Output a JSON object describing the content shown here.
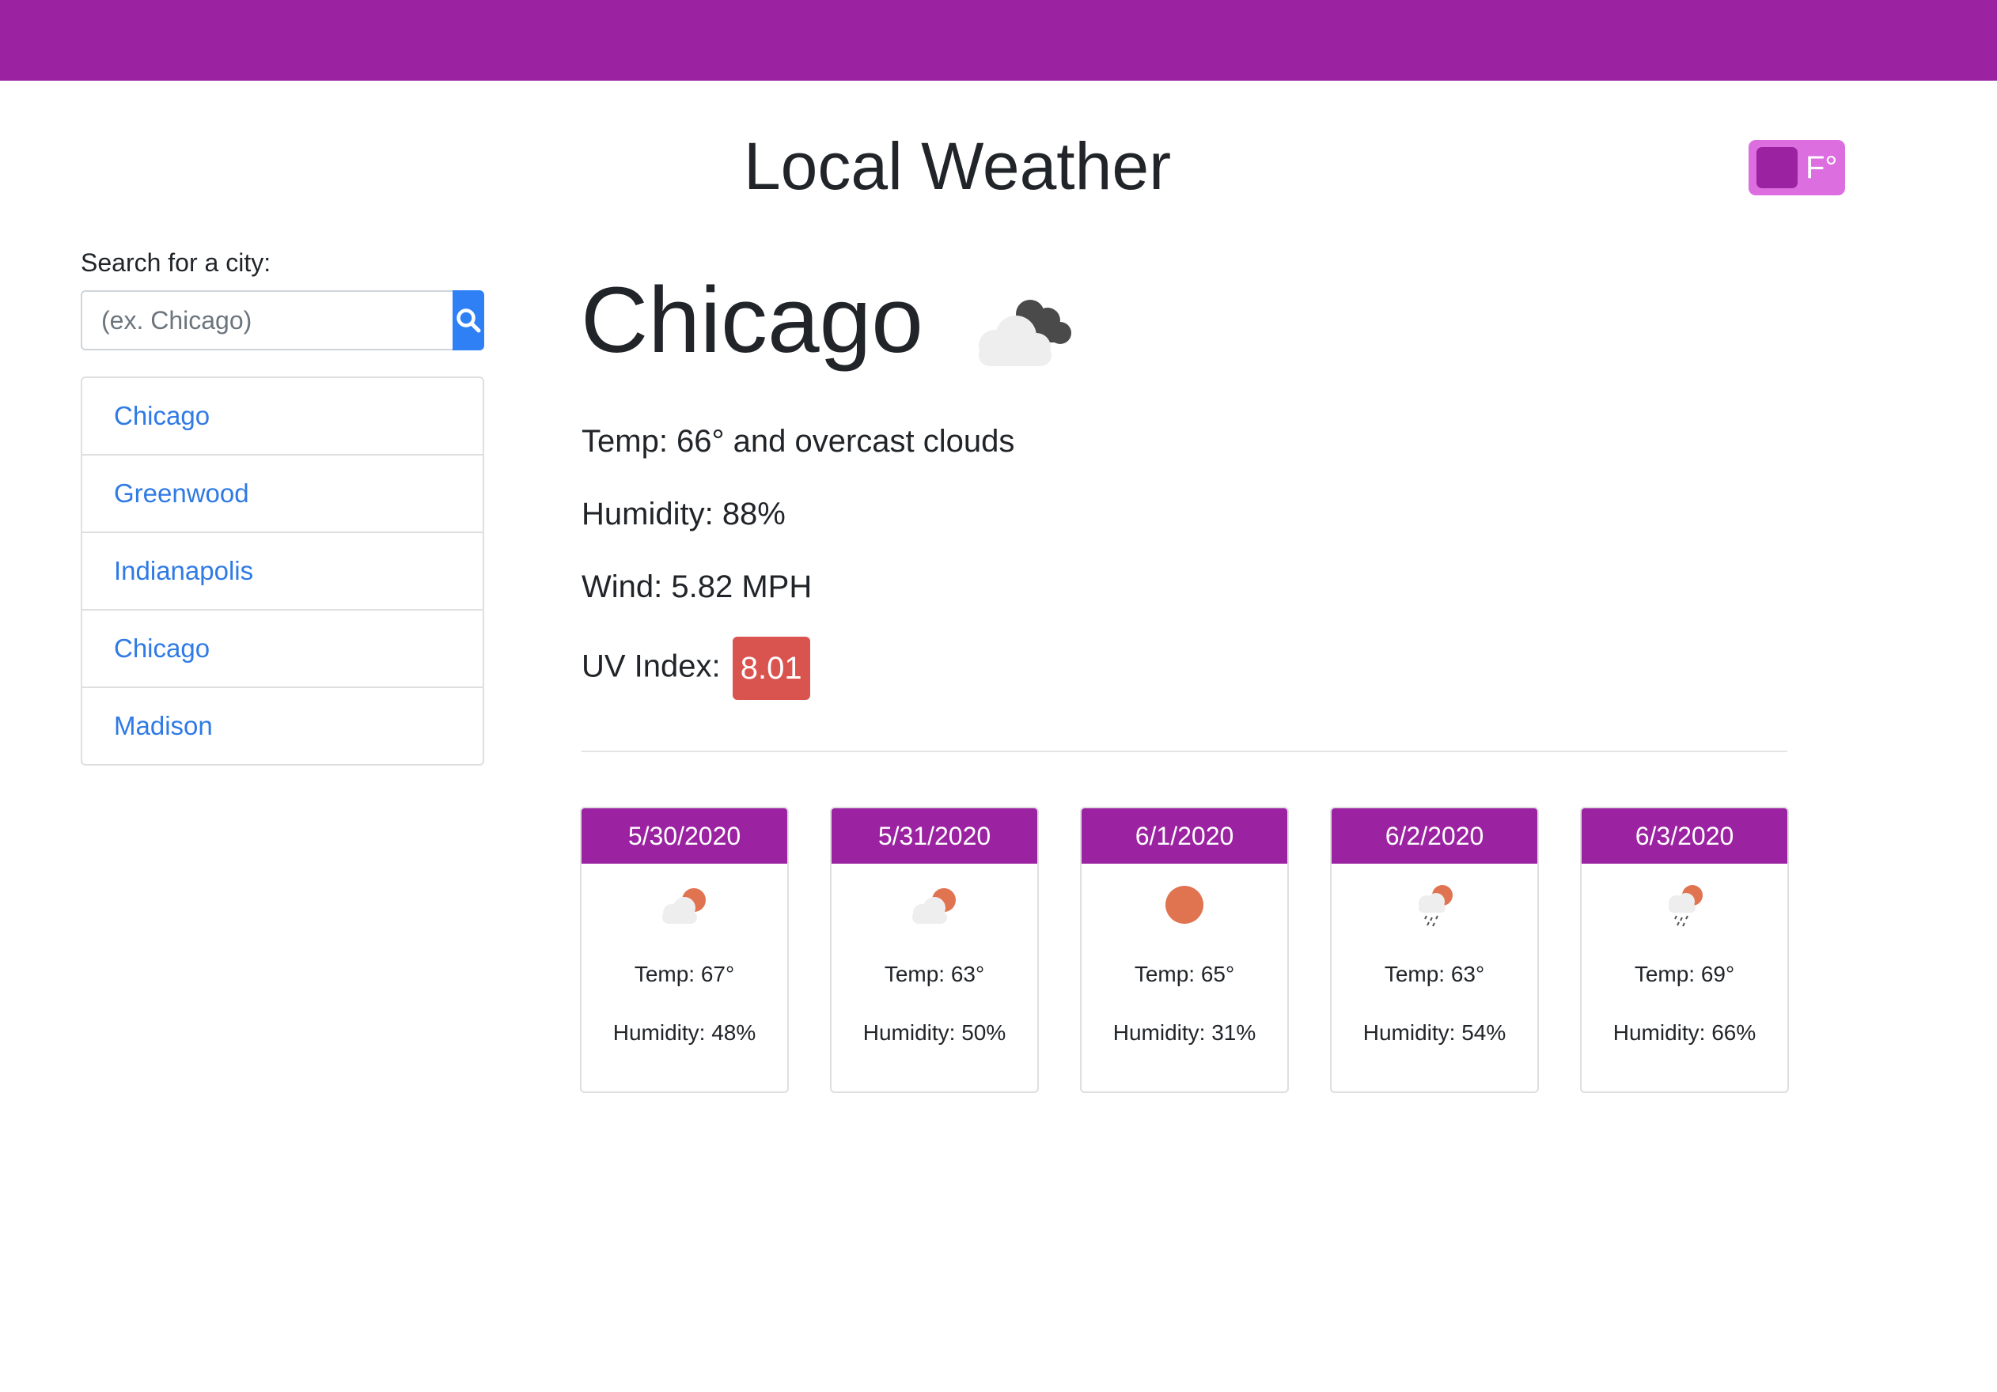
{
  "header": {
    "title": "Local Weather",
    "unit_toggle_label": "F°"
  },
  "sidebar": {
    "search_label": "Search for a city:",
    "search_placeholder": "(ex. Chicago)",
    "search_icon": "search-icon",
    "cities": [
      {
        "name": "Chicago"
      },
      {
        "name": "Greenwood"
      },
      {
        "name": "Indianapolis"
      },
      {
        "name": "Chicago"
      },
      {
        "name": "Madison"
      }
    ]
  },
  "current": {
    "city": "Chicago",
    "icon": "overcast-clouds-icon",
    "temp_line": "Temp: 66° and overcast clouds",
    "humidity_line": "Humidity: 88%",
    "wind_line": "Wind: 5.82 MPH",
    "uv_label": "UV Index:",
    "uv_value": "8.01"
  },
  "forecast": [
    {
      "date": "5/30/2020",
      "icon": "partly-cloudy-icon",
      "temp": "Temp: 67°",
      "humidity": "Humidity: 48%"
    },
    {
      "date": "5/31/2020",
      "icon": "partly-cloudy-icon",
      "temp": "Temp: 63°",
      "humidity": "Humidity: 50%"
    },
    {
      "date": "6/1/2020",
      "icon": "sun-icon",
      "temp": "Temp: 65°",
      "humidity": "Humidity: 31%"
    },
    {
      "date": "6/2/2020",
      "icon": "sun-rain-icon",
      "temp": "Temp: 63°",
      "humidity": "Humidity: 54%"
    },
    {
      "date": "6/3/2020",
      "icon": "sun-rain-icon",
      "temp": "Temp: 69°",
      "humidity": "Humidity: 66%"
    }
  ],
  "colors": {
    "brand_purple": "#9b22a1",
    "toggle_pink": "#dc6ee0",
    "search_blue": "#2f80f5",
    "link_blue": "#2f7ae5",
    "uv_red": "#d9534f",
    "sun_orange": "#e07350"
  }
}
